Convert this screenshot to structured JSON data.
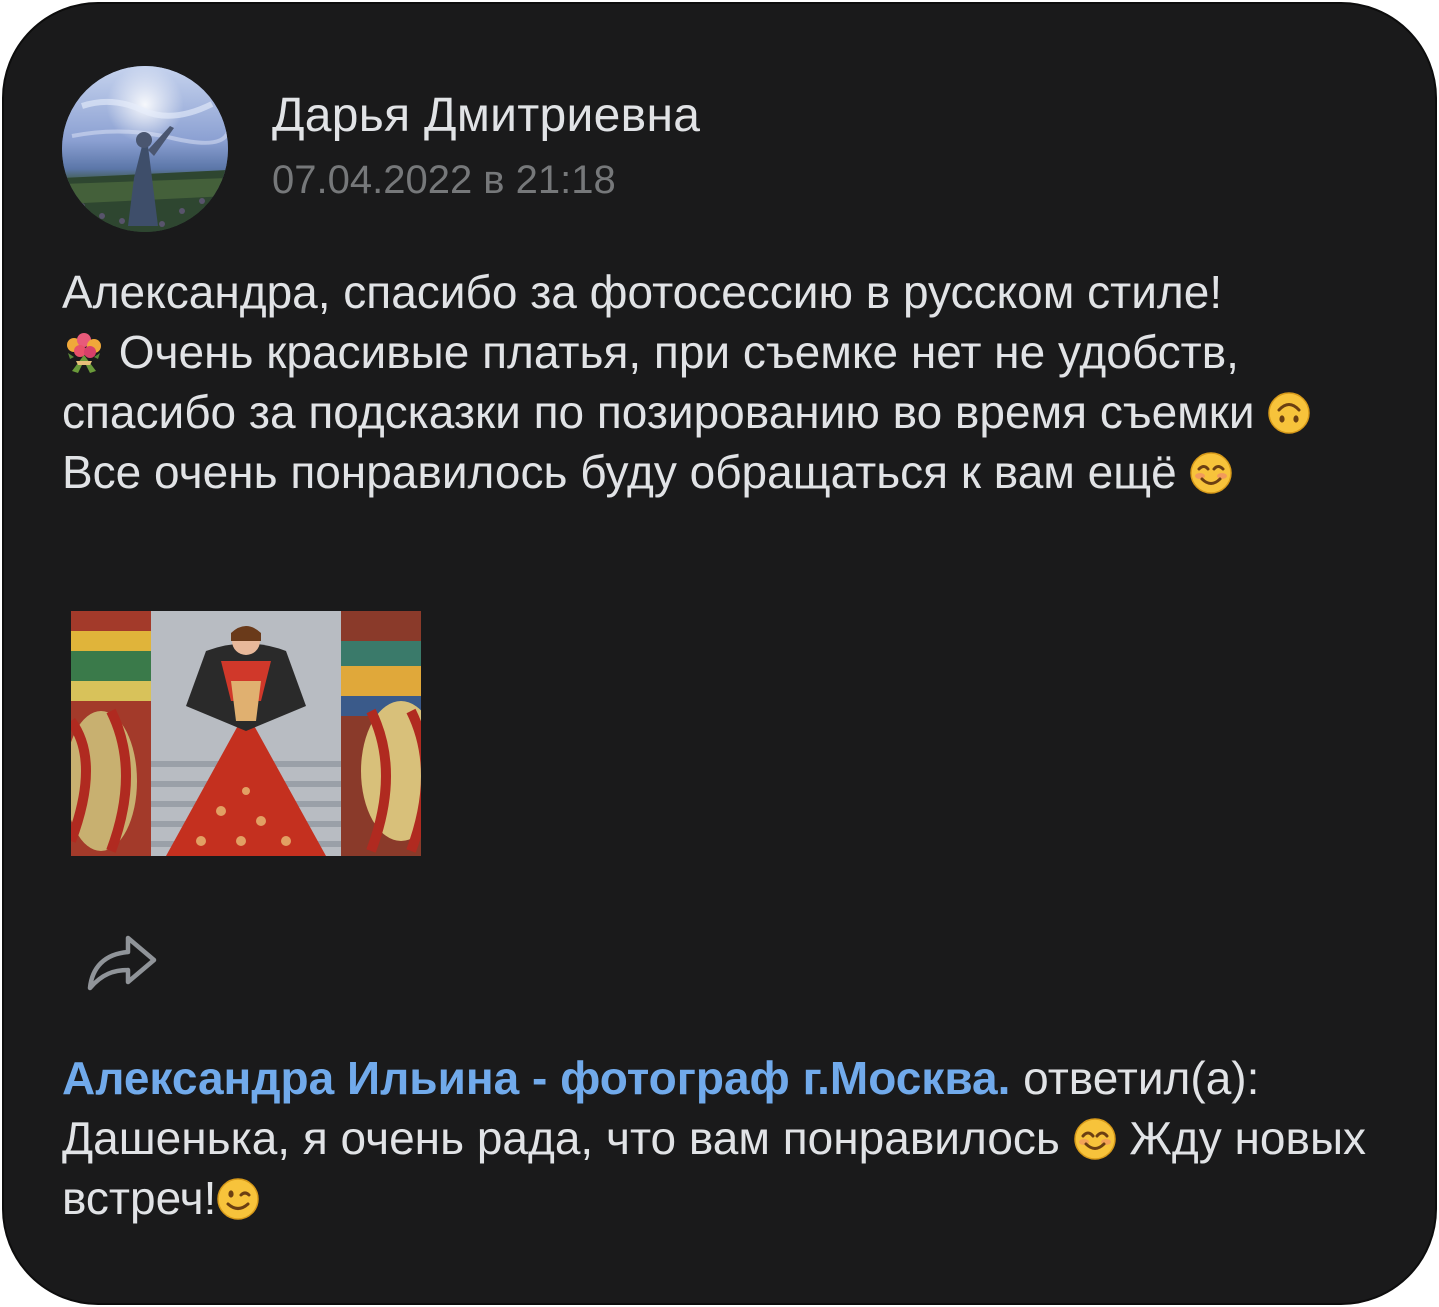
{
  "post": {
    "author_name": "Дарья Дмитриевна",
    "date": "07.04.2022 в 21:18",
    "text_parts": [
      "Александра, спасибо за фотосессию в русском стиле!",
      " Очень красивые платья, при съемке нет не удобств, спасибо за подсказки по позированию во время съемки ",
      " Все очень понравилось буду обращаться к вам ещё "
    ],
    "icons": [
      "bouquet-emoji",
      "upside-down-face-emoji",
      "smiling-face-emoji",
      "share-icon"
    ]
  },
  "reply": {
    "author": "Александра Ильина - фотограф г.Москва.",
    "verb": " ответил(а):",
    "text_before": "Дашенька, я очень рада, что вам понравилось ",
    "text_middle": " Жду новых встреч!",
    "icons": [
      "smiling-eyes-emoji",
      "winking-face-emoji"
    ]
  },
  "colors": {
    "background": "#1a1a1b",
    "text": "#e1e3e6",
    "secondary_text": "#76787a",
    "link": "#71aaeb"
  }
}
